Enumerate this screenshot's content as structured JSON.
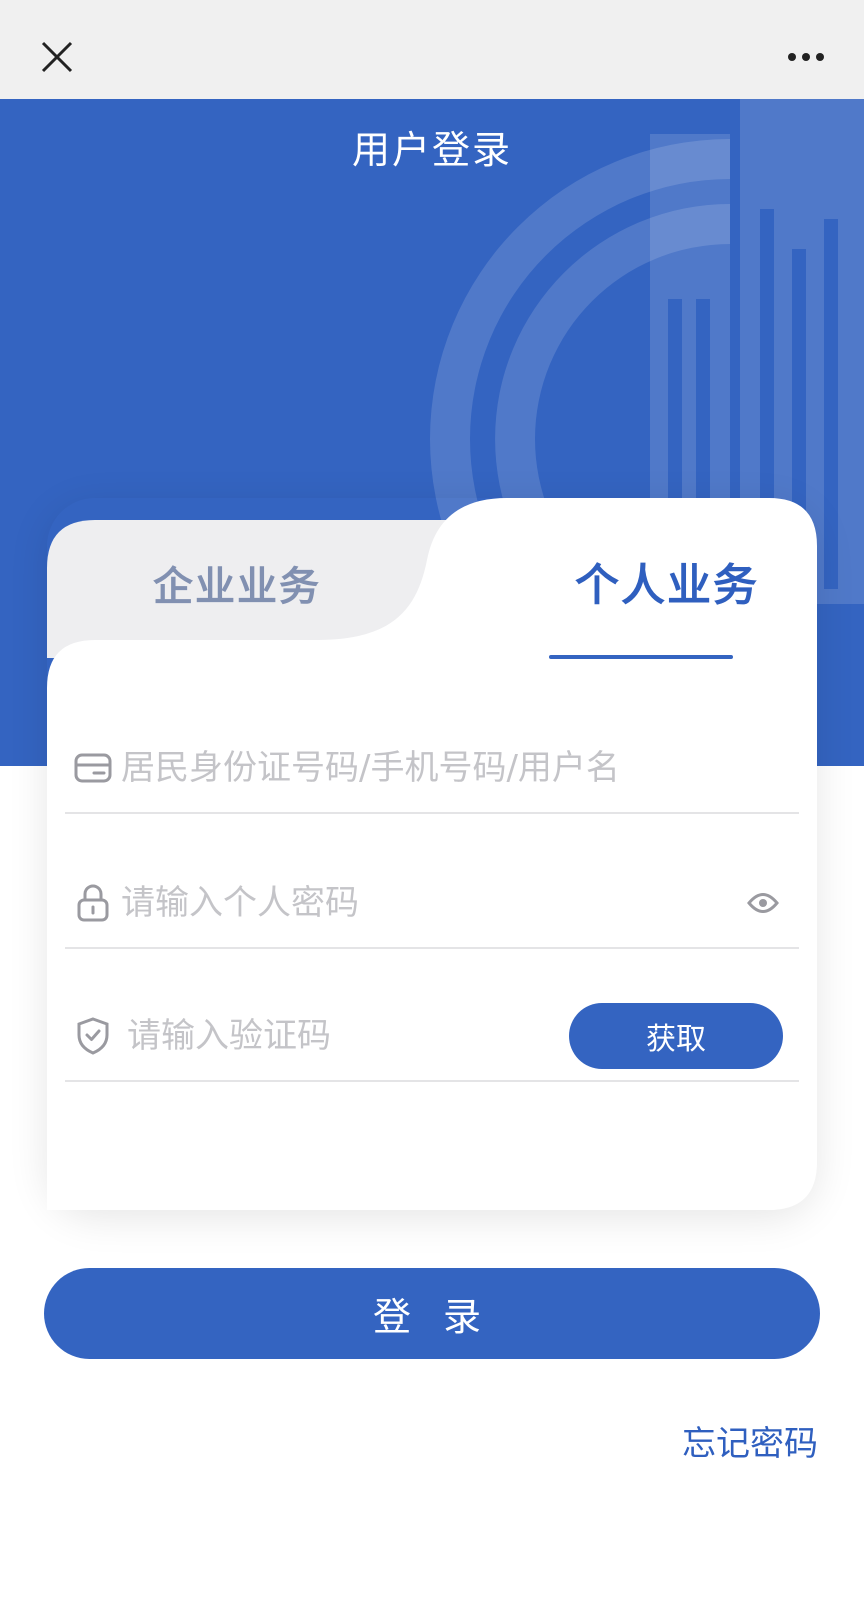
{
  "topbar": {
    "close_icon": "close-icon",
    "more_icon": "more-dots-icon"
  },
  "header": {
    "title": "用户登录"
  },
  "tabs": {
    "company": "企业业务",
    "personal": "个人业务",
    "active": "personal"
  },
  "form": {
    "account_placeholder": "居民身份证号码/手机号码/用户名",
    "password_placeholder": "请输入个人密码",
    "code_placeholder": "请输入验证码",
    "get_code_label": "获取",
    "account_icon": "id-card-icon",
    "password_icon": "lock-icon",
    "code_icon": "shield-check-icon",
    "visibility_icon": "eye-icon"
  },
  "actions": {
    "login_label": "登 录",
    "forgot_label": "忘记密码"
  },
  "colors": {
    "primary": "#3464c1",
    "tab_inactive_text": "#8190b1",
    "placeholder": "#c4c4c8"
  }
}
